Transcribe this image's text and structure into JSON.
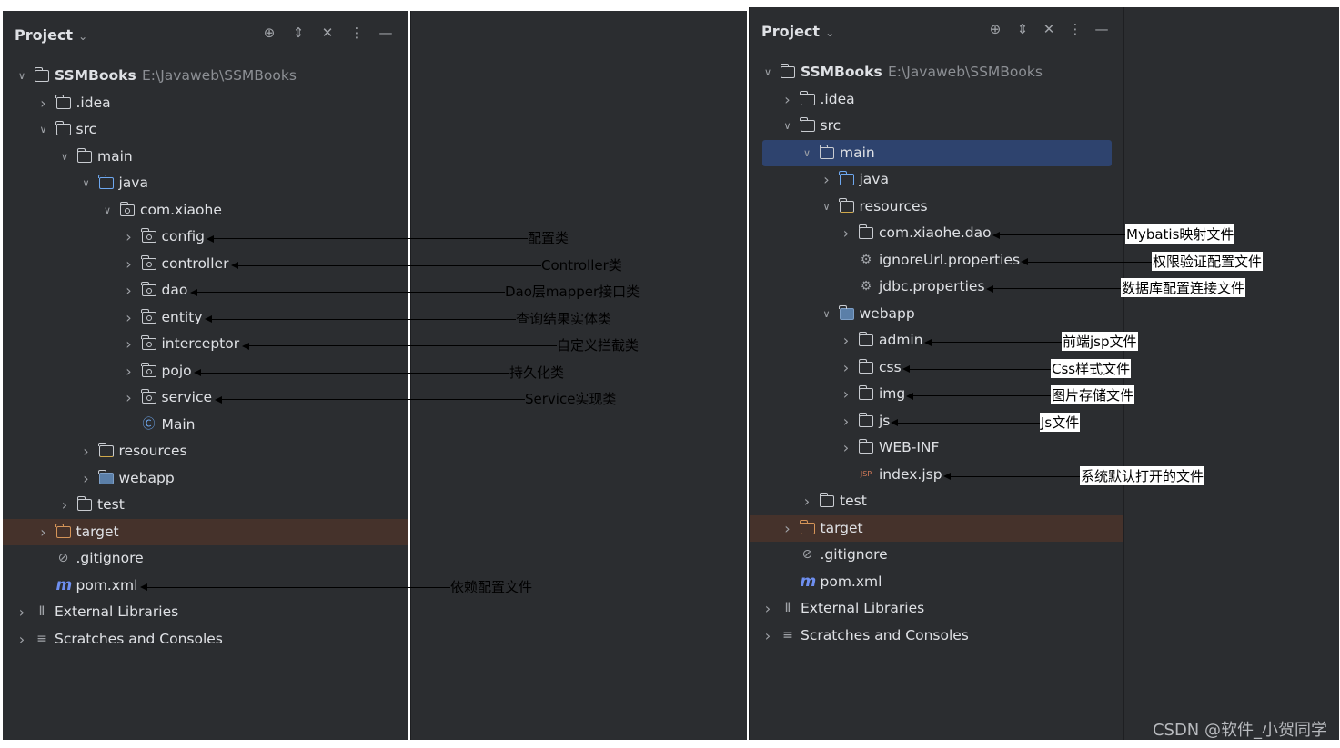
{
  "left_panel": {
    "title": "Project",
    "tree": [
      {
        "label": "SSMBooks",
        "path": "E:\\Javaweb\\SSMBooks",
        "arrow": "v",
        "icon": "module-folder-icon",
        "bold": true
      },
      {
        "label": ".idea",
        "arrow": ">",
        "icon": "folder-icon"
      },
      {
        "label": "src",
        "arrow": "v",
        "icon": "folder-icon"
      },
      {
        "label": "main",
        "arrow": "v",
        "icon": "folder-icon"
      },
      {
        "label": "java",
        "arrow": "v",
        "icon": "source-folder-icon"
      },
      {
        "label": "com.xiaohe",
        "arrow": "v",
        "icon": "package-icon"
      },
      {
        "label": "config",
        "arrow": ">",
        "icon": "package-icon"
      },
      {
        "label": "controller",
        "arrow": ">",
        "icon": "package-icon"
      },
      {
        "label": "dao",
        "arrow": ">",
        "icon": "package-icon"
      },
      {
        "label": "entity",
        "arrow": ">",
        "icon": "package-icon"
      },
      {
        "label": "interceptor",
        "arrow": ">",
        "icon": "package-icon"
      },
      {
        "label": "pojo",
        "arrow": ">",
        "icon": "package-icon"
      },
      {
        "label": "service",
        "arrow": ">",
        "icon": "package-icon"
      },
      {
        "label": "Main",
        "arrow": "",
        "icon": "class-icon"
      },
      {
        "label": "resources",
        "arrow": ">",
        "icon": "resources-folder-icon"
      },
      {
        "label": "webapp",
        "arrow": ">",
        "icon": "web-folder-icon"
      },
      {
        "label": "test",
        "arrow": ">",
        "icon": "folder-icon"
      },
      {
        "label": "target",
        "arrow": ">",
        "icon": "excluded-folder-icon"
      },
      {
        "label": ".gitignore",
        "arrow": "",
        "icon": "ignore-file-icon"
      },
      {
        "label": "pom.xml",
        "arrow": "",
        "icon": "maven-icon"
      },
      {
        "label": "External Libraries",
        "arrow": ">",
        "icon": "libraries-icon"
      },
      {
        "label": "Scratches and Consoles",
        "arrow": ">",
        "icon": "scratches-icon"
      }
    ],
    "annotations": [
      {
        "text": "配置类",
        "row": 6
      },
      {
        "text": "Controller类",
        "row": 7
      },
      {
        "text": "Dao层mapper接口类",
        "row": 8
      },
      {
        "text": "查询结果实体类",
        "row": 9
      },
      {
        "text": "自定义拦截类",
        "row": 10
      },
      {
        "text": "持久化类",
        "row": 11
      },
      {
        "text": "Service实现类",
        "row": 12
      },
      {
        "text": "依赖配置文件",
        "row": 19
      }
    ]
  },
  "right_panel": {
    "title": "Project",
    "tree": [
      {
        "label": "SSMBooks",
        "path": "E:\\Javaweb\\SSMBooks",
        "arrow": "v",
        "icon": "module-folder-icon",
        "bold": true
      },
      {
        "label": ".idea",
        "arrow": ">",
        "icon": "folder-icon"
      },
      {
        "label": "src",
        "arrow": "v",
        "icon": "folder-icon"
      },
      {
        "label": "main",
        "arrow": "v",
        "icon": "folder-icon",
        "selected": true
      },
      {
        "label": "java",
        "arrow": ">",
        "icon": "source-folder-icon"
      },
      {
        "label": "resources",
        "arrow": "v",
        "icon": "resources-folder-icon"
      },
      {
        "label": "com.xiaohe.dao",
        "arrow": ">",
        "icon": "folder-icon"
      },
      {
        "label": "ignoreUrl.properties",
        "arrow": "",
        "icon": "properties-icon"
      },
      {
        "label": "jdbc.properties",
        "arrow": "",
        "icon": "properties-icon"
      },
      {
        "label": "webapp",
        "arrow": "v",
        "icon": "web-folder-icon"
      },
      {
        "label": "admin",
        "arrow": ">",
        "icon": "folder-icon"
      },
      {
        "label": "css",
        "arrow": ">",
        "icon": "folder-icon"
      },
      {
        "label": "img",
        "arrow": ">",
        "icon": "folder-icon"
      },
      {
        "label": "js",
        "arrow": ">",
        "icon": "folder-icon"
      },
      {
        "label": "WEB-INF",
        "arrow": ">",
        "icon": "folder-icon"
      },
      {
        "label": "index.jsp",
        "arrow": "",
        "icon": "jsp-icon"
      },
      {
        "label": "test",
        "arrow": ">",
        "icon": "folder-icon"
      },
      {
        "label": "target",
        "arrow": ">",
        "icon": "excluded-folder-icon"
      },
      {
        "label": ".gitignore",
        "arrow": "",
        "icon": "ignore-file-icon"
      },
      {
        "label": "pom.xml",
        "arrow": "",
        "icon": "maven-icon"
      },
      {
        "label": "External Libraries",
        "arrow": ">",
        "icon": "libraries-icon"
      },
      {
        "label": "Scratches and Consoles",
        "arrow": ">",
        "icon": "scratches-icon"
      }
    ],
    "annotations": [
      {
        "text": "Mybatis映射文件",
        "row": 6
      },
      {
        "text": "权限验证配置文件",
        "row": 7
      },
      {
        "text": "数据库配置连接文件",
        "row": 8
      },
      {
        "text": "前端jsp文件",
        "row": 10
      },
      {
        "text": "Css样式文件",
        "row": 11
      },
      {
        "text": "图片存储文件",
        "row": 12
      },
      {
        "text": "Js文件",
        "row": 13
      },
      {
        "text": "系统默认打开的文件",
        "row": 15
      }
    ]
  },
  "watermark": "CSDN @软件_小贺同学",
  "colors": {
    "bg": "#2b2d30",
    "selected": "#2e436e",
    "target_bg": "#45322b",
    "source_blue": "#6ea8f0",
    "excluded_orange": "#d59458"
  }
}
